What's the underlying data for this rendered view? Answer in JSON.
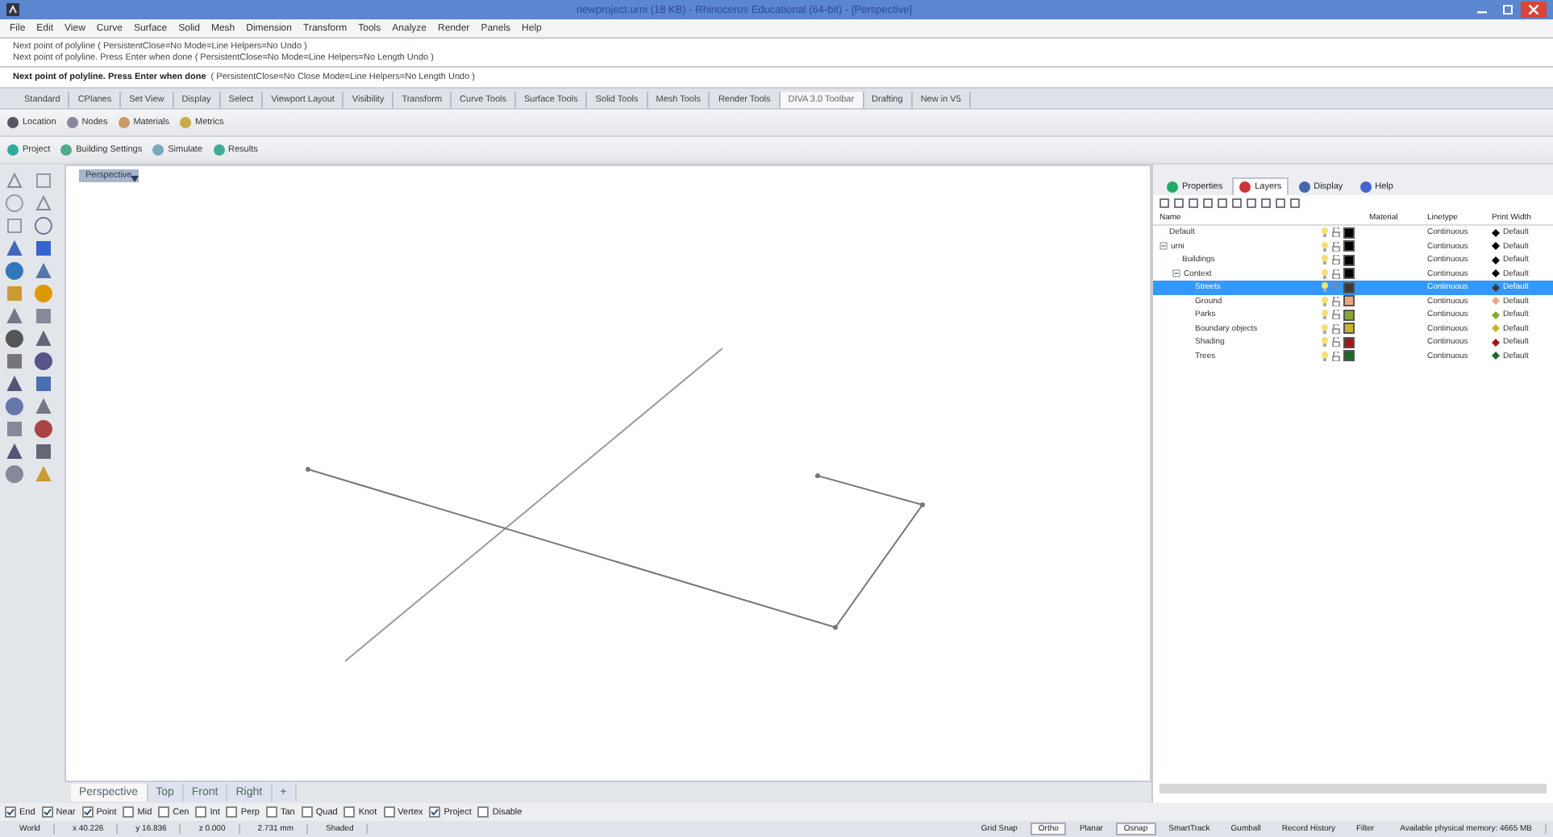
{
  "window": {
    "title": "newproject.urni (18 KB) - Rhinoceros Educational (64-bit) - [Perspective]"
  },
  "menu": [
    "File",
    "Edit",
    "View",
    "Curve",
    "Surface",
    "Solid",
    "Mesh",
    "Dimension",
    "Transform",
    "Tools",
    "Analyze",
    "Render",
    "Panels",
    "Help"
  ],
  "command_history": [
    "Next point of polyline ( PersistentClose=No  Mode=Line  Helpers=No  Undo )",
    "Next point of polyline. Press Enter when done ( PersistentClose=No  Mode=Line  Helpers=No  Length  Undo )"
  ],
  "command_prompt": {
    "prompt": "Next point of polyline. Press Enter when done",
    "options": "( PersistentClose=No  Close  Mode=Line  Helpers=No  Length  Undo )"
  },
  "toolbar_tabs": [
    {
      "label": "Standard",
      "selected": false
    },
    {
      "label": "CPlanes",
      "selected": false
    },
    {
      "label": "Set View",
      "selected": false
    },
    {
      "label": "Display",
      "selected": false
    },
    {
      "label": "Select",
      "selected": false
    },
    {
      "label": "Viewport Layout",
      "selected": false
    },
    {
      "label": "Visibility",
      "selected": false
    },
    {
      "label": "Transform",
      "selected": false
    },
    {
      "label": "Curve Tools",
      "selected": false
    },
    {
      "label": "Surface Tools",
      "selected": false
    },
    {
      "label": "Solid Tools",
      "selected": false
    },
    {
      "label": "Mesh Tools",
      "selected": false
    },
    {
      "label": "Render Tools",
      "selected": false
    },
    {
      "label": "DIVA 3.0 Toolbar",
      "selected": true
    },
    {
      "label": "Drafting",
      "selected": false
    },
    {
      "label": "New in V5",
      "selected": false
    }
  ],
  "diva_row_1": [
    "Location",
    "Nodes",
    "Materials",
    "Metrics"
  ],
  "diva_row_2": [
    "Project",
    "Building Settings",
    "Simulate",
    "Results"
  ],
  "viewport": {
    "label": "Perspective"
  },
  "viewport_tabs": [
    {
      "label": "Perspective",
      "selected": true
    },
    {
      "label": "Top",
      "selected": false
    },
    {
      "label": "Front",
      "selected": false
    },
    {
      "label": "Right",
      "selected": false
    },
    {
      "label": "+",
      "selected": false
    }
  ],
  "panel_tabs": [
    {
      "label": "Properties",
      "selected": false
    },
    {
      "label": "Layers",
      "selected": true
    },
    {
      "label": "Display",
      "selected": false
    },
    {
      "label": "Help",
      "selected": false
    }
  ],
  "layer_columns": [
    "Name",
    "Material",
    "Linetype",
    "Print Width"
  ],
  "layers": [
    {
      "name": "Default",
      "color": "#000000",
      "selected": false,
      "linetype": "Continuous",
      "print_width": "Default"
    },
    {
      "name": "urni",
      "color": "#000000",
      "selected": false,
      "expanded": true,
      "linetype": "Continuous",
      "print_width": "Default",
      "children": [
        {
          "name": "Buildings",
          "color": "#000000",
          "selected": false,
          "linetype": "Continuous",
          "print_width": "Default"
        },
        {
          "name": "Context",
          "color": "#000000",
          "selected": false,
          "expanded": true,
          "linetype": "Continuous",
          "print_width": "Default",
          "children": [
            {
              "name": "Streets",
              "color": "#3a3a3a",
              "selected": true,
              "linetype": "Continuous",
              "print_width": "Default"
            },
            {
              "name": "Ground",
              "color": "#e8a888",
              "selected": false,
              "linetype": "Continuous",
              "print_width": "Default"
            },
            {
              "name": "Parks",
              "color": "#86a832",
              "selected": false,
              "linetype": "Continuous",
              "print_width": "Default"
            },
            {
              "name": "Boundary objects",
              "color": "#c8b428",
              "selected": false,
              "linetype": "Continuous",
              "print_width": "Default"
            },
            {
              "name": "Shading",
              "color": "#a01818",
              "selected": false,
              "linetype": "Continuous",
              "print_width": "Default"
            },
            {
              "name": "Trees",
              "color": "#1a6a2a",
              "selected": false,
              "linetype": "Continuous",
              "print_width": "Default"
            }
          ]
        }
      ]
    }
  ],
  "osnaps": [
    {
      "label": "End",
      "checked": true
    },
    {
      "label": "Near",
      "checked": true
    },
    {
      "label": "Point",
      "checked": true
    },
    {
      "label": "Mid",
      "checked": false
    },
    {
      "label": "Cen",
      "checked": false
    },
    {
      "label": "Int",
      "checked": false
    },
    {
      "label": "Perp",
      "checked": false
    },
    {
      "label": "Tan",
      "checked": false
    },
    {
      "label": "Quad",
      "checked": false
    },
    {
      "label": "Knot",
      "checked": false
    },
    {
      "label": "Vertex",
      "checked": false
    },
    {
      "label": "Project",
      "checked": true
    },
    {
      "label": "Disable",
      "checked": false
    }
  ],
  "status_bar": {
    "fields": [
      "World",
      "x 40.226",
      "y 16.836",
      "z 0.000",
      "2.731 mm",
      "Shaded"
    ],
    "toggles": [
      {
        "label": "Grid Snap",
        "on": false
      },
      {
        "label": "Ortho",
        "on": true
      },
      {
        "label": "Planar",
        "on": false
      },
      {
        "label": "Osnap",
        "on": true
      },
      {
        "label": "SmartTrack",
        "on": false
      },
      {
        "label": "Gumball",
        "on": false
      },
      {
        "label": "Record History",
        "on": false
      },
      {
        "label": "Filter",
        "on": false
      }
    ],
    "memory": "Available physical memory: 4665 MB"
  }
}
